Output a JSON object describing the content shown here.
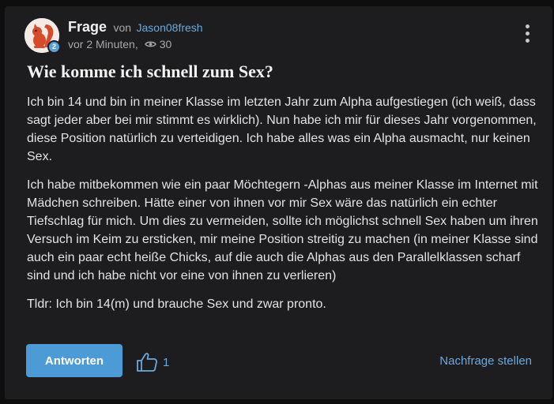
{
  "question": {
    "label": "Frage",
    "von": "von",
    "author": "Jason08fresh",
    "time": "vor 2 Minuten,",
    "views": "30",
    "avatar_badge": "2",
    "title": "Wie komme ich schnell zum Sex?",
    "paragraphs": [
      "Ich bin 14 und bin in meiner Klasse im letzten Jahr zum Alpha aufgestiegen (ich weiß, dass sagt jeder aber bei mir stimmt es wirklich). Nun habe ich mir für dieses Jahr vorgenommen, diese Position natürlich zu verteidigen. Ich habe alles was ein Alpha ausmacht, nur keinen Sex.",
      "Ich habe mitbekommen wie ein paar Möchtegern -Alphas aus meiner Klasse im Internet mit Mädchen schreiben. Hätte einer von ihnen vor mir Sex wäre das natürlich ein echter Tiefschlag für mich. Um dies zu vermeiden, sollte ich möglichst schnell Sex haben um ihren Versuch im Keim zu ersticken, mir meine Position streitig zu machen (in meiner Klasse sind auch ein paar echt heiße Chicks, auf die auch die Alphas aus den Parallelklassen scharf sind und ich habe nicht vor eine von ihnen zu verlieren)",
      "Tldr: Ich bin 14(m) und brauche Sex und zwar pronto."
    ]
  },
  "actions": {
    "answer_label": "Antworten",
    "like_count": "1",
    "followup_label": "Nachfrage stellen"
  },
  "icons": {
    "views": "eye-icon",
    "like": "thumbs-up-icon",
    "menu": "more-vertical-icon"
  },
  "colors": {
    "accent": "#4d9bd6",
    "link": "#6aa9de",
    "background": "#1d1d1f"
  }
}
